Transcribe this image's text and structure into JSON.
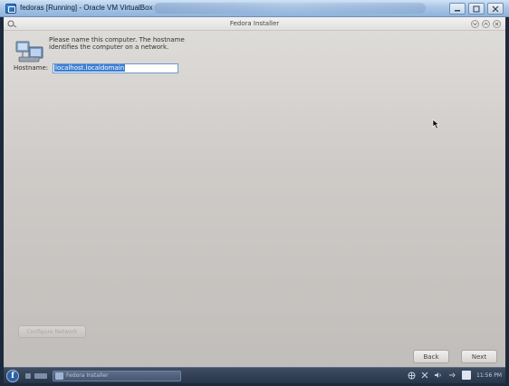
{
  "window": {
    "title": "fedoras [Running] - Oracle VM VirtualBox",
    "controls": {
      "minimize": "▭",
      "maximize": "▢",
      "close": "✕"
    }
  },
  "installer": {
    "title": "Fedora Installer",
    "description": "Please name this computer.  The hostname identifies the computer on a network.",
    "hostname_label": "Hostname:",
    "hostname_value": "localhost.localdomain",
    "configure_network_label": "Configure Network",
    "back_label": "Back",
    "next_label": "Next"
  },
  "taskbar": {
    "task_label": "Fedora Installer",
    "clock": "11:56 PM"
  },
  "colors": {
    "selection": "#3b7fd4",
    "taskbar": "#27344a",
    "installer_bg": "#cfcbc8"
  }
}
